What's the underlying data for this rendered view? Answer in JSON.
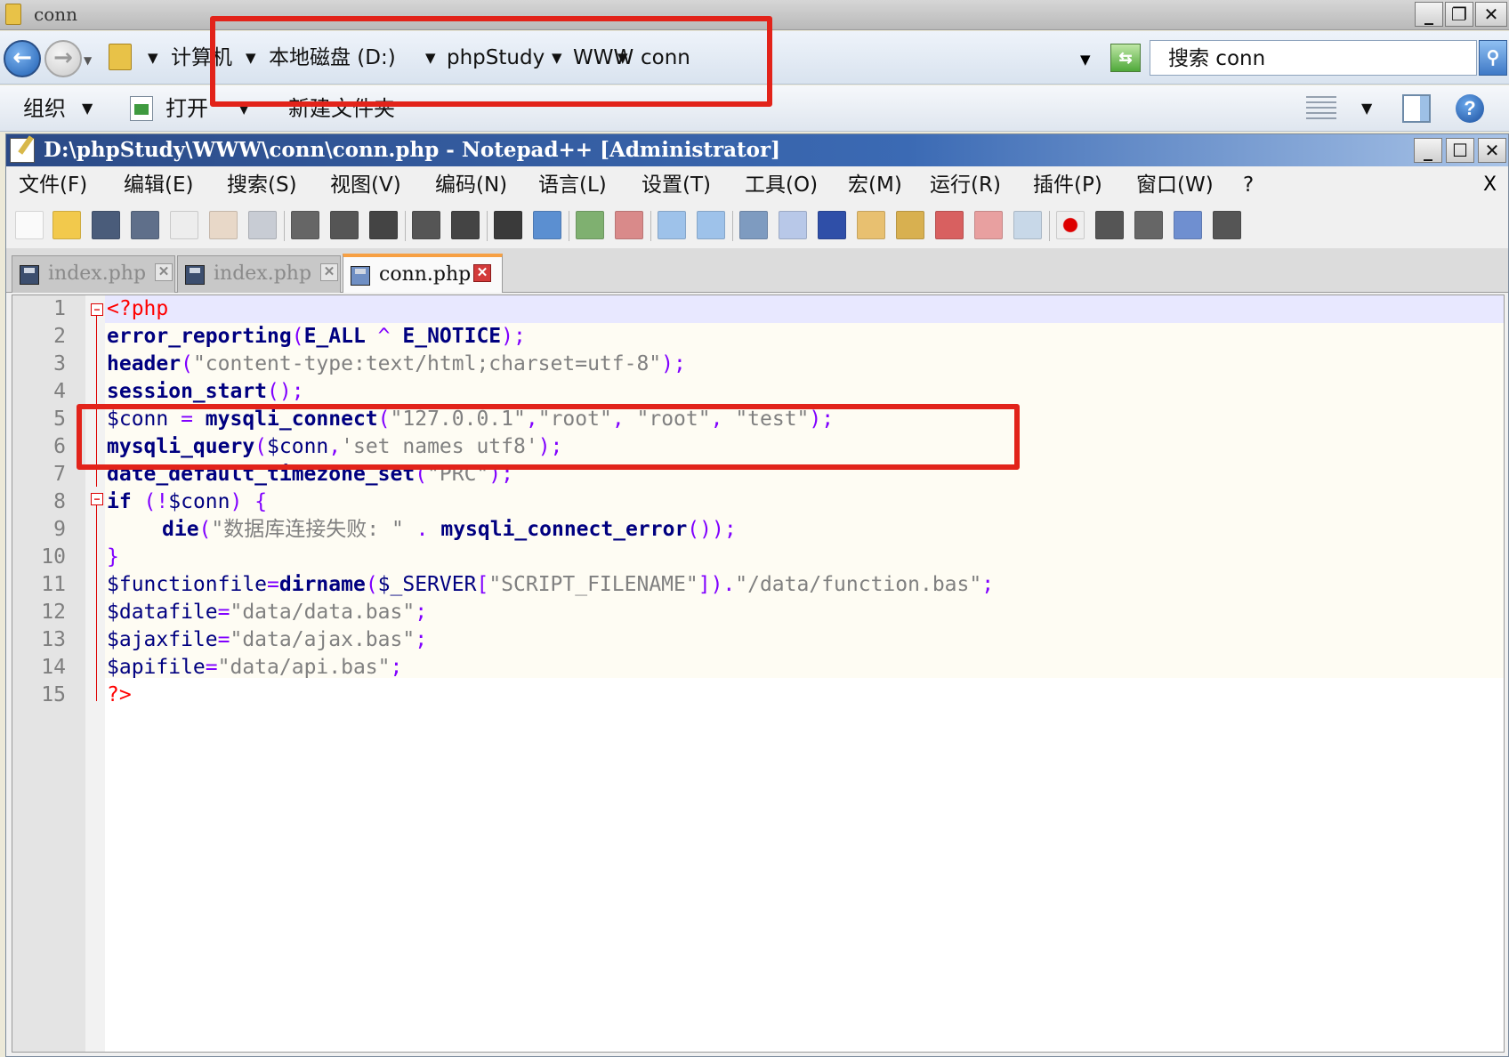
{
  "explorer": {
    "title": "conn",
    "breadcrumb": [
      "计算机",
      "本地磁盘 (D:)",
      "phpStudy",
      "WWW",
      "conn"
    ],
    "search_text": "搜索 conn",
    "commands": {
      "organize": "组织",
      "open": "打开",
      "new_folder": "新建文件夹"
    }
  },
  "npp": {
    "title": "D:\\phpStudy\\WWW\\conn\\conn.php - Notepad++ [Administrator]",
    "menu": [
      "文件(F)",
      "编辑(E)",
      "搜索(S)",
      "视图(V)",
      "编码(N)",
      "语言(L)",
      "设置(T)",
      "工具(O)",
      "宏(M)",
      "运行(R)",
      "插件(P)",
      "窗口(W)",
      "?"
    ],
    "menu_close": "X",
    "tabs": [
      {
        "label": "index.php",
        "active": false
      },
      {
        "label": "index.php",
        "active": false
      },
      {
        "label": "conn.php",
        "active": true
      }
    ],
    "code": {
      "l1": {
        "num": "1",
        "t1": "<?php"
      },
      "l2": {
        "num": "2",
        "t1": "error_reporting",
        "t2": "(",
        "t3": "E_ALL",
        "t4": " ^ ",
        "t5": "E_NOTICE",
        "t6": ");"
      },
      "l3": {
        "num": "3",
        "t1": "header",
        "t2": "(",
        "t3": "\"content-type:text/html;charset=utf-8\"",
        "t4": ");"
      },
      "l4": {
        "num": "4",
        "t1": "session_start",
        "t2": "();"
      },
      "l5": {
        "num": "5",
        "t1": "$conn",
        "t2": " = ",
        "t3": "mysqli_connect",
        "t4": "(",
        "t5": "\"127.0.0.1\"",
        "t6": ",",
        "t7": "\"root\"",
        "t8": ", ",
        "t9": "\"root\"",
        "t10": ", ",
        "t11": "\"test\"",
        "t12": ");"
      },
      "l6": {
        "num": "6",
        "t1": "mysqli_query",
        "t2": "(",
        "t3": "$conn",
        "t4": ",",
        "t5": "'set names utf8'",
        "t6": ");"
      },
      "l7": {
        "num": "7",
        "t1": "date_default_timezone_set",
        "t2": "(",
        "t3": "\"PRC\"",
        "t4": ");"
      },
      "l8": {
        "num": "8",
        "t1": "if",
        "t2": " (!",
        "t3": "$conn",
        "t4": ") {"
      },
      "l9": {
        "num": "9",
        "t1": "die",
        "t2": "(",
        "t3": "\"数据库连接失败: \"",
        "t4": " . ",
        "t5": "mysqli_connect_error",
        "t6": "());"
      },
      "l10": {
        "num": "10",
        "t1": "}"
      },
      "l11": {
        "num": "11",
        "t1": "$functionfile",
        "t2": "=",
        "t3": "dirname",
        "t4": "(",
        "t5": "$_SERVER",
        "t6": "[",
        "t7": "\"SCRIPT_FILENAME\"",
        "t8": "]).",
        "t9": "\"/data/function.bas\"",
        "t10": ";"
      },
      "l12": {
        "num": "12",
        "t1": "$datafile",
        "t2": "=",
        "t3": "\"data/data.bas\"",
        "t4": ";"
      },
      "l13": {
        "num": "13",
        "t1": "$ajaxfile",
        "t2": "=",
        "t3": "\"data/ajax.bas\"",
        "t4": ";"
      },
      "l14": {
        "num": "14",
        "t1": "$apifile",
        "t2": "=",
        "t3": "\"data/api.bas\"",
        "t4": ";"
      },
      "l15": {
        "num": "15",
        "t1": "?>"
      }
    }
  },
  "colors": {
    "annotation": "#e2231a",
    "keyword": "#000080",
    "string": "#808080",
    "operator": "#8000ff",
    "php_tag": "#ff0000"
  }
}
